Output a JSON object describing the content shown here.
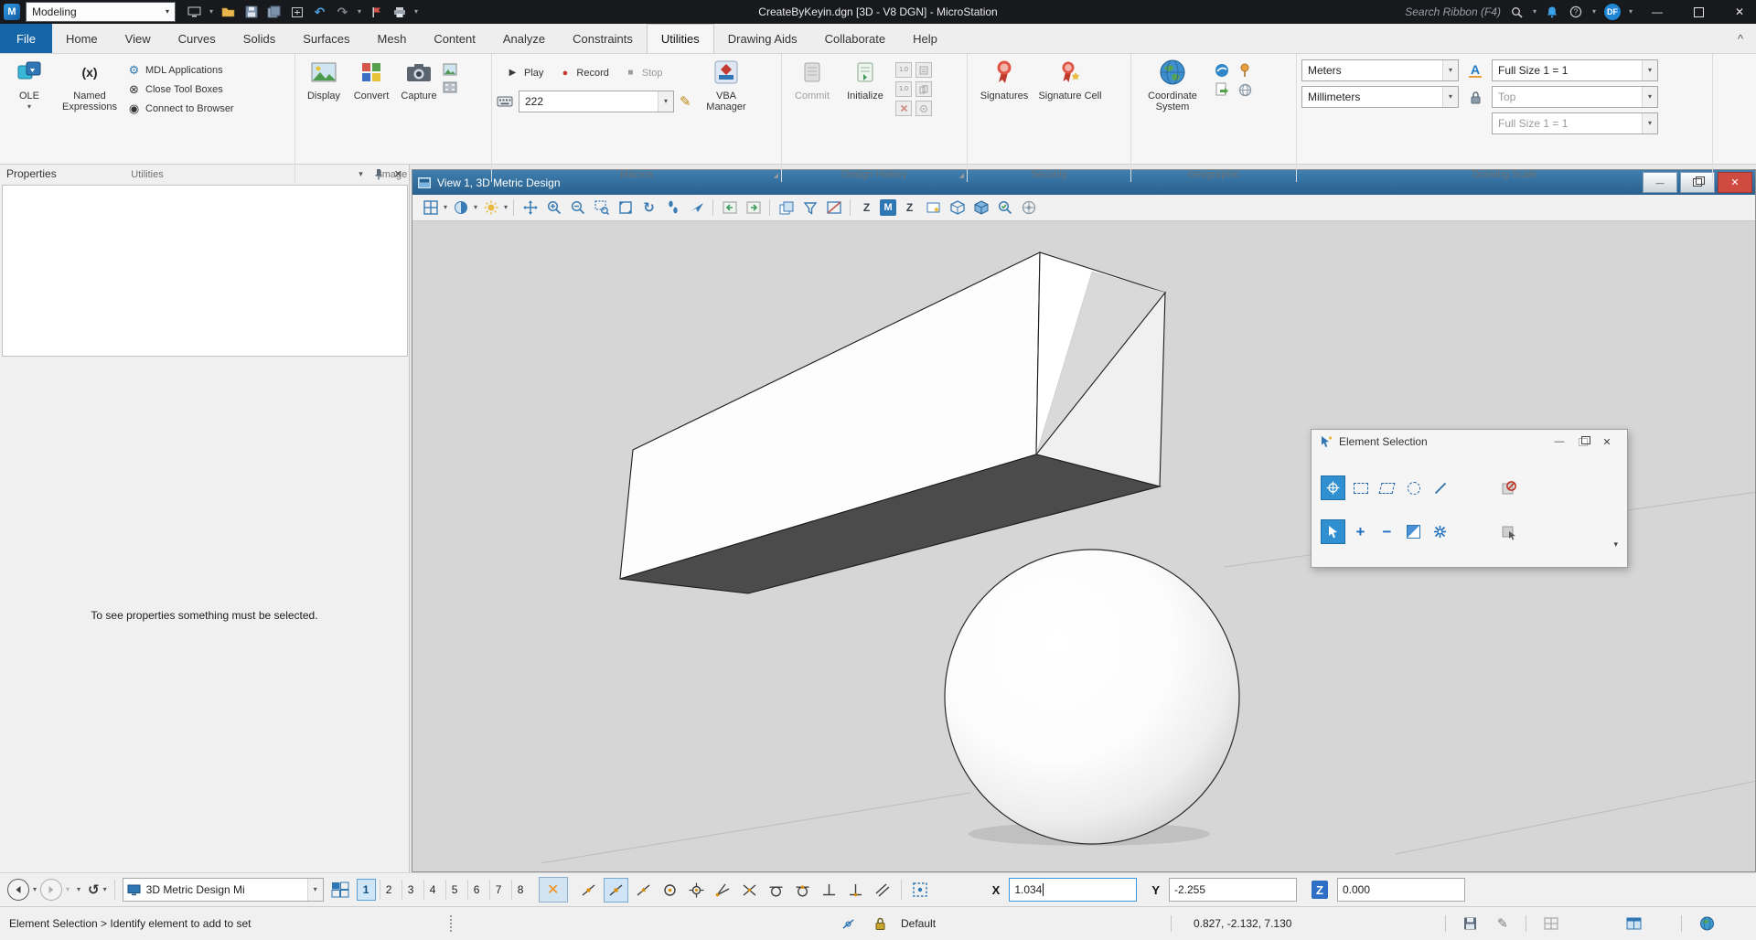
{
  "titlebar": {
    "workflow": "Modeling",
    "title": "CreateByKeyin.dgn [3D - V8 DGN] - MicroStation",
    "search_placeholder": "Search Ribbon (F4)",
    "avatar_initials": "DF"
  },
  "tabs": {
    "file": "File",
    "items": [
      "Home",
      "View",
      "Curves",
      "Solids",
      "Surfaces",
      "Mesh",
      "Content",
      "Analyze",
      "Constraints",
      "Utilities",
      "Drawing Aids",
      "Collaborate",
      "Help"
    ],
    "active": "Utilities"
  },
  "ribbon": {
    "utilities_group": {
      "label": "Utilities",
      "ole": "OLE",
      "named_expressions": "Named Expressions",
      "mdl_applications": "MDL Applications",
      "close_tool_boxes": "Close Tool Boxes",
      "connect_to_browser": "Connect to Browser"
    },
    "image_group": {
      "label": "Image",
      "display": "Display",
      "convert": "Convert",
      "capture": "Capture"
    },
    "macros_group": {
      "label": "Macros",
      "play": "Play",
      "record": "Record",
      "stop": "Stop",
      "macro_name": "222",
      "vba_manager": "VBA Manager"
    },
    "design_history_group": {
      "label": "Design History",
      "commit": "Commit",
      "initialize": "Initialize",
      "version_tag": "1.0"
    },
    "security_group": {
      "label": "Security",
      "signatures": "Signatures",
      "signature_cell": "Signature Cell"
    },
    "geographic_group": {
      "label": "Geographic",
      "coordinate_system": "Coordinate System"
    },
    "drawing_scale_group": {
      "label": "Drawing Scale",
      "units": "Meters",
      "sub_units": "Millimeters",
      "annotation_letter": "A",
      "scale": "Full Size 1 = 1",
      "view_name": "Top",
      "sheet_scale": "Full Size 1 = 1"
    }
  },
  "properties_panel": {
    "title": "Properties",
    "empty_message": "To see properties something must be selected."
  },
  "view_window": {
    "title": "View 1, 3D Metric Design"
  },
  "element_selection_dialog": {
    "title": "Element Selection"
  },
  "bottom_toolbar": {
    "view_group": "3D Metric Design Mi",
    "view_numbers": [
      "1",
      "2",
      "3",
      "4",
      "5",
      "6",
      "7",
      "8"
    ],
    "active_view": "1",
    "x_label": "X",
    "x_value": "1.034",
    "y_label": "Y",
    "y_value": "-2.255",
    "z_label": "Z",
    "z_value": "0.000"
  },
  "status_bar": {
    "message": "Element Selection > Identify element to add to set",
    "active_level": "Default",
    "coordinates": "0.827, -2.132, 7.130"
  },
  "icons": {
    "caret_down": "▾",
    "caret_up": "^",
    "play": "▶",
    "record": "●",
    "stop": "■",
    "close": "✕",
    "minimize": "—",
    "named_expressions": "(x)",
    "pencil": "✎",
    "gear": "⚙",
    "circle_x": "⊗",
    "circle_dot": "◉",
    "undo": "↶",
    "redo": "↷",
    "plus": "+",
    "minus": "−",
    "letter_m": "M",
    "letter_z": "Z",
    "rotate": "↻",
    "history": "↺",
    "launcher": "◢"
  }
}
